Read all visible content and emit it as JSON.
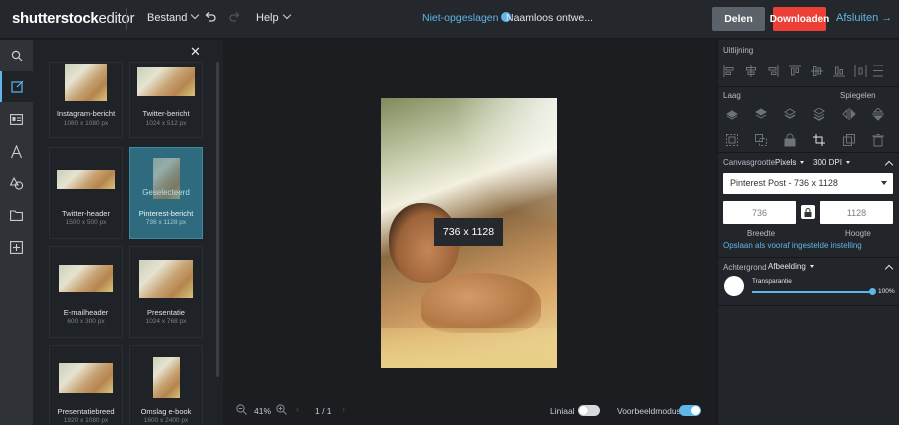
{
  "header": {
    "logo": "shutterstock",
    "logo_suffix": "editor",
    "menu_file": "Bestand",
    "menu_help": "Help",
    "save_status": "Niet-opgeslagen",
    "doc_name": "Naamloos ontwe...",
    "share": "Delen",
    "download": "Downloaden",
    "close": "Afsluiten"
  },
  "templates": [
    {
      "name": "Instagram-bericht",
      "size": "1080 x 1080 px"
    },
    {
      "name": "Twitter-bericht",
      "size": "1024 x 512 px"
    },
    {
      "name": "Twitter-header",
      "size": "1500 x 500 px"
    },
    {
      "name": "Pinterest-bericht",
      "size": "736 x 1128 px",
      "overlay": "Geselecteerd",
      "selected": true
    },
    {
      "name": "E-mailheader",
      "size": "600 x 300 px"
    },
    {
      "name": "Presentatie",
      "size": "1024 x 768 px"
    },
    {
      "name": "Presentatiebreed",
      "size": "1920 x 1080 px"
    },
    {
      "name": "Omslag e-book",
      "size": "1600 x 2400 px"
    }
  ],
  "canvas": {
    "dimension_badge": "736 x 1128"
  },
  "bottom": {
    "zoom": "41%",
    "page": "1 / 1",
    "ruler": "Liniaal",
    "ruler_on": false,
    "preview": "Voorbeeldmodus",
    "preview_on": true
  },
  "right": {
    "align_label": "Uitlijning",
    "layer_label": "Laag",
    "mirror_label": "Spiegelen",
    "canvas_size_label": "Canvasgrootte",
    "unit": "Pixels",
    "dpi_value": "300",
    "dpi_label": "DPI",
    "preset": "Pinterest Post - 736 x 1128",
    "width_value": "736",
    "height_value": "1128",
    "width_label": "Breedte",
    "height_label": "Hoogte",
    "save_preset": "Opslaan als vooraf ingestelde instelling",
    "background_label": "Achtergrond",
    "background_type": "Afbeelding",
    "transparency_label": "Transparantie",
    "transparency_value": "100%",
    "transparency_fraction": 1.0
  },
  "colors": {
    "accent": "#5fb6e8",
    "download": "#ec3f36",
    "selected_tile": "#2f6b7e"
  }
}
